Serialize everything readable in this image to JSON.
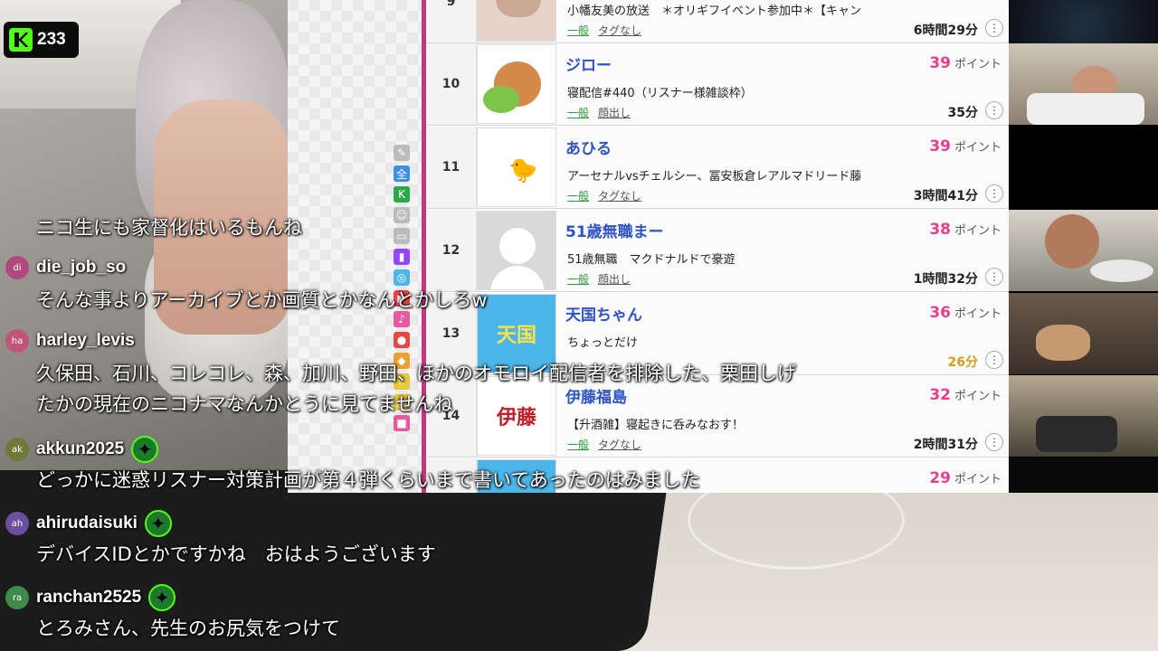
{
  "kick": {
    "viewer_count": "233",
    "brand_color": "#53fc18"
  },
  "ranking": {
    "rows": [
      {
        "rank": "9",
        "name": "",
        "points_value": "",
        "points_unit": "",
        "desc": "小幡友美の放送　＊オリギフイベント参加中＊【キャン",
        "category": "一般",
        "tag": "タグなし",
        "duration": "6時間29分",
        "thumb_color": "#e8d3c9"
      },
      {
        "rank": "10",
        "name": "ジロー",
        "points_value": "39",
        "points_unit": "ポイント",
        "desc": "寝配信#440（リスナー様雑談枠）",
        "category": "一般",
        "tag": "顔出し",
        "duration": "35分",
        "thumb_color": "#ffffff"
      },
      {
        "rank": "11",
        "name": "あひる",
        "points_value": "39",
        "points_unit": "ポイント",
        "desc": "アーセナルvsチェルシー、冨安板倉レアルマドリード藤",
        "category": "一般",
        "tag": "タグなし",
        "duration": "3時間41分",
        "thumb_color": "#ffffff"
      },
      {
        "rank": "12",
        "name": "51歳無職まー",
        "points_value": "38",
        "points_unit": "ポイント",
        "desc": "51歳無職　マクドナルドで豪遊",
        "category": "一般",
        "tag": "顔出し",
        "duration": "1時間32分",
        "thumb_color": "#d9d9d9"
      },
      {
        "rank": "13",
        "name": "天国ちゃん",
        "points_value": "36",
        "points_unit": "ポイント",
        "desc": "ちょっとだけ",
        "category": "",
        "tag": "",
        "duration": "26分",
        "thumb_color": "#4db6e8",
        "thumb_text": "天国"
      },
      {
        "rank": "14",
        "name": "伊藤福島",
        "points_value": "32",
        "points_unit": "ポイント",
        "desc": "【升酒雑】寝起きに呑みなおす！",
        "category": "一般",
        "tag": "タグなし",
        "duration": "2時間31分",
        "thumb_color": "#ffffff",
        "thumb_text": "伊藤"
      },
      {
        "rank": "",
        "name": "",
        "points_value": "29",
        "points_unit": "ポイント",
        "desc": "",
        "category": "",
        "tag": "",
        "duration": "",
        "thumb_color": "#4db6e8"
      }
    ],
    "strip_icons": [
      {
        "name": "edit-icon",
        "glyph": "✎",
        "color": "#bbbbbb"
      },
      {
        "name": "all-icon",
        "glyph": "全",
        "color": "#3d8ee8"
      },
      {
        "name": "kick-filter-icon",
        "glyph": "K",
        "color": "#2aa84a"
      },
      {
        "name": "person-icon",
        "glyph": "☺",
        "color": "#bbbbbb"
      },
      {
        "name": "tv-icon",
        "glyph": "▭",
        "color": "#bbbbbb"
      },
      {
        "name": "twitch-icon",
        "glyph": "▮",
        "color": "#9146ff"
      },
      {
        "name": "circle-icon",
        "glyph": "◎",
        "color": "#4db6e8"
      },
      {
        "name": "youtube-icon",
        "glyph": "▶",
        "color": "#e84545"
      },
      {
        "name": "tiktok-icon",
        "glyph": "♪",
        "color": "#e85aa0"
      },
      {
        "name": "red-icon",
        "glyph": "●",
        "color": "#e84545"
      },
      {
        "name": "orange-icon",
        "glyph": "◆",
        "color": "#f0a030"
      },
      {
        "name": "yellow-icon",
        "glyph": "☆",
        "color": "#e6c83a"
      },
      {
        "name": "frame-icon",
        "glyph": "▣",
        "color": "#e6c83a"
      },
      {
        "name": "pink-icon",
        "glyph": "■",
        "color": "#e85aa0"
      }
    ]
  },
  "chat": {
    "messages": [
      {
        "user": "",
        "initials": "",
        "avatar_color": "",
        "badge": false,
        "text": "ニコ生にも家督化はいるもんね"
      },
      {
        "user": "die_job_so",
        "initials": "di",
        "avatar_color": "#b04a7e",
        "badge": false,
        "text": "そんな事よりアーカイブとか画質とかなんとかしろw"
      },
      {
        "user": "harley_levis",
        "initials": "ha",
        "avatar_color": "#c0557a",
        "badge": false,
        "text": "久保田、石川、コレコレ、森、加川、野田、ほかのオモロイ配信者を排除した、栗田しげ",
        "text2": "たかの現在のニコナマなんかとうに見てませんね"
      },
      {
        "user": "akkun2025",
        "initials": "ak",
        "avatar_color": "#6f7a3a",
        "badge": true,
        "text": "どっかに迷惑リスナー対策計画が第４弾くらいまで書いてあったのはみました"
      },
      {
        "user": "ahirudaisuki",
        "initials": "ah",
        "avatar_color": "#6a4fa0",
        "badge": true,
        "text": "デバイスIDとかですかね　おはようございます"
      },
      {
        "user": "ranchan2525",
        "initials": "ra",
        "avatar_color": "#3f8a4a",
        "badge": true,
        "text": "とろみさん、先生のお尻気をつけて"
      }
    ]
  }
}
